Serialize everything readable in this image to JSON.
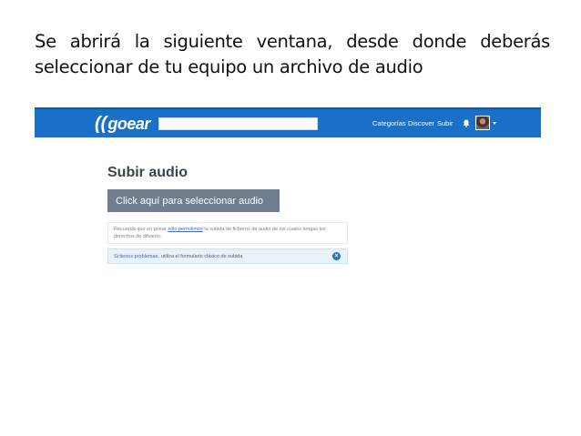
{
  "caption": {
    "line1": "Se abrirá la siguiente ventana, desde donde deberás",
    "line2": "seleccionar de tu equipo un archivo de audio"
  },
  "header": {
    "logo_mark": "((",
    "logo_text": "goear",
    "search": {
      "value": "",
      "placeholder": ""
    },
    "nav": [
      "Categorías",
      "Discover",
      "Subir"
    ],
    "icons": [
      "bell-icon",
      "avatar",
      "caret-down-icon"
    ],
    "color": "#1a6fc6"
  },
  "main": {
    "title": "Subir audio",
    "upload_button": "Click aquí para seleccionar audio",
    "notice": {
      "before": "Recuerda que en goear ",
      "link": "sólo permitimos",
      "after": " la subida de ficheros de audio de los cuales tengas los derechos de difusión."
    },
    "problem": {
      "lead": "Si tienes problemas,",
      "rest": "utiliza el formulario clásico de subida",
      "close_icon": "close-icon"
    }
  }
}
